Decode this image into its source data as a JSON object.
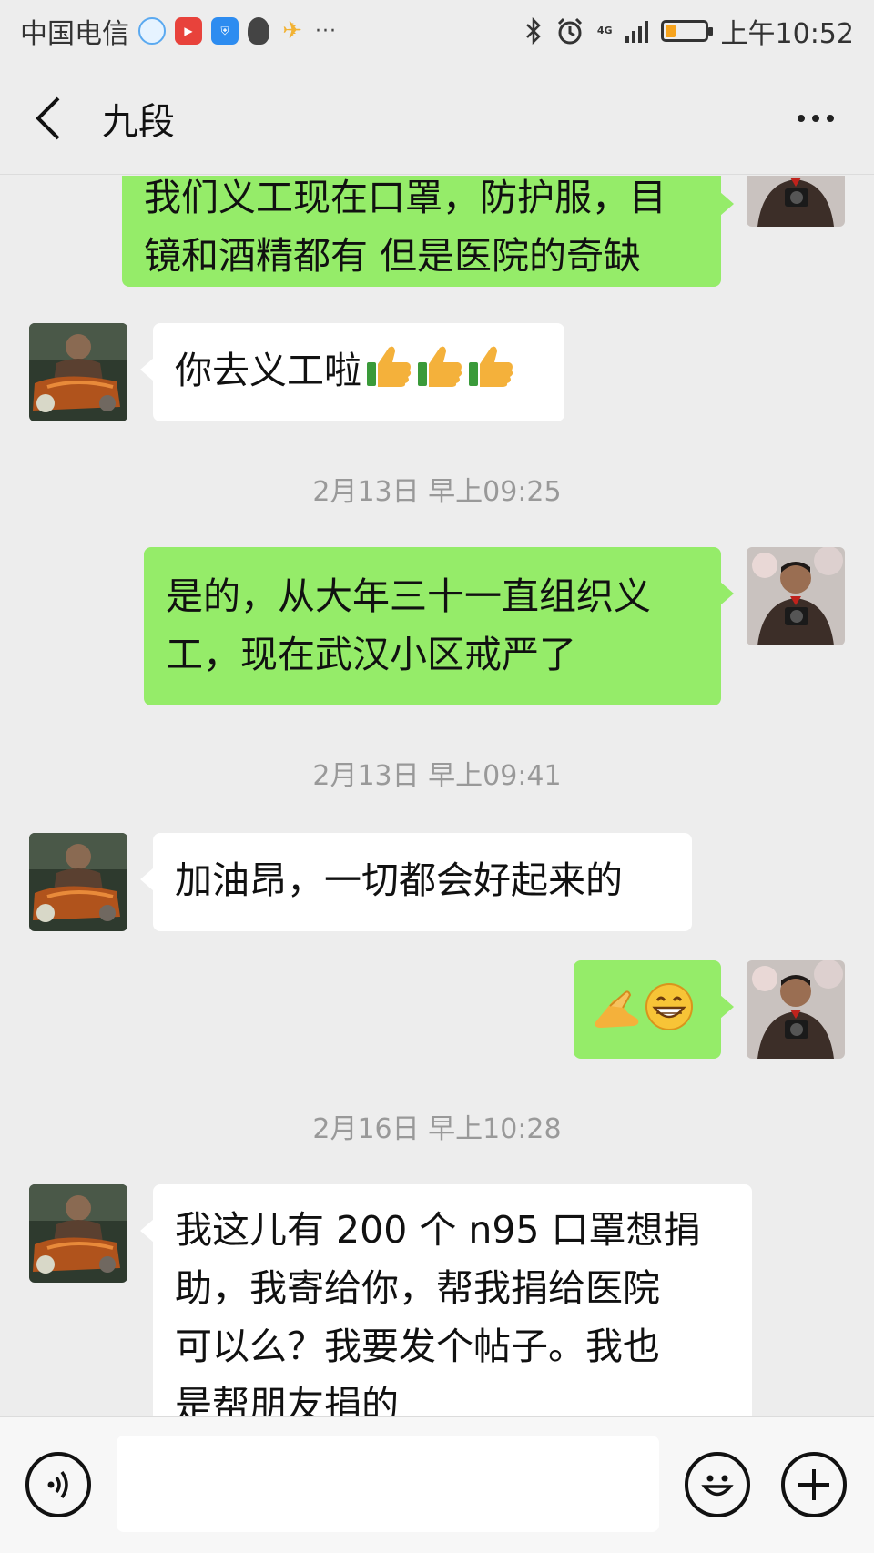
{
  "status_bar": {
    "carrier": "中国电信",
    "network": "4G",
    "time": "上午10:52",
    "battery_level": 0.25,
    "overflow": "···"
  },
  "header": {
    "title": "九段"
  },
  "messages": [
    {
      "side": "out",
      "text_line1": "我们义工现在口罩，防护服，目",
      "text_line2": "镜和酒精都有 但是医院的奇缺"
    },
    {
      "side": "in",
      "text": "你去义工啦"
    },
    {
      "type": "time",
      "text": "2月13日 早上09:25"
    },
    {
      "side": "out",
      "text_line1": "是的，从大年三十一直组织义",
      "text_line2": "工，现在武汉小区戒严了"
    },
    {
      "type": "time",
      "text": "2月13日 早上09:41"
    },
    {
      "side": "in",
      "text": "加油昂，一切都会好起来的"
    },
    {
      "side": "out",
      "text": ""
    },
    {
      "type": "time",
      "text": "2月16日 早上10:28"
    },
    {
      "side": "in",
      "text_line1": "我这儿有 200 个 n95 口罩想捐",
      "text_line2": "助，我寄给你，帮我捐给医院",
      "text_line3": "可以么？我要发个帖子。我也",
      "text_line4": "是帮朋友捐的"
    }
  ],
  "colors": {
    "sent_bubble": "#95ec69",
    "received_bubble": "#ffffff",
    "background": "#ededed"
  },
  "icons": [
    "back-arrow-icon",
    "more-icon",
    "voice-icon",
    "emoji-icon",
    "plus-icon",
    "thumbs-up-icon",
    "grin-emoji-icon",
    "fist-palm-icon"
  ]
}
